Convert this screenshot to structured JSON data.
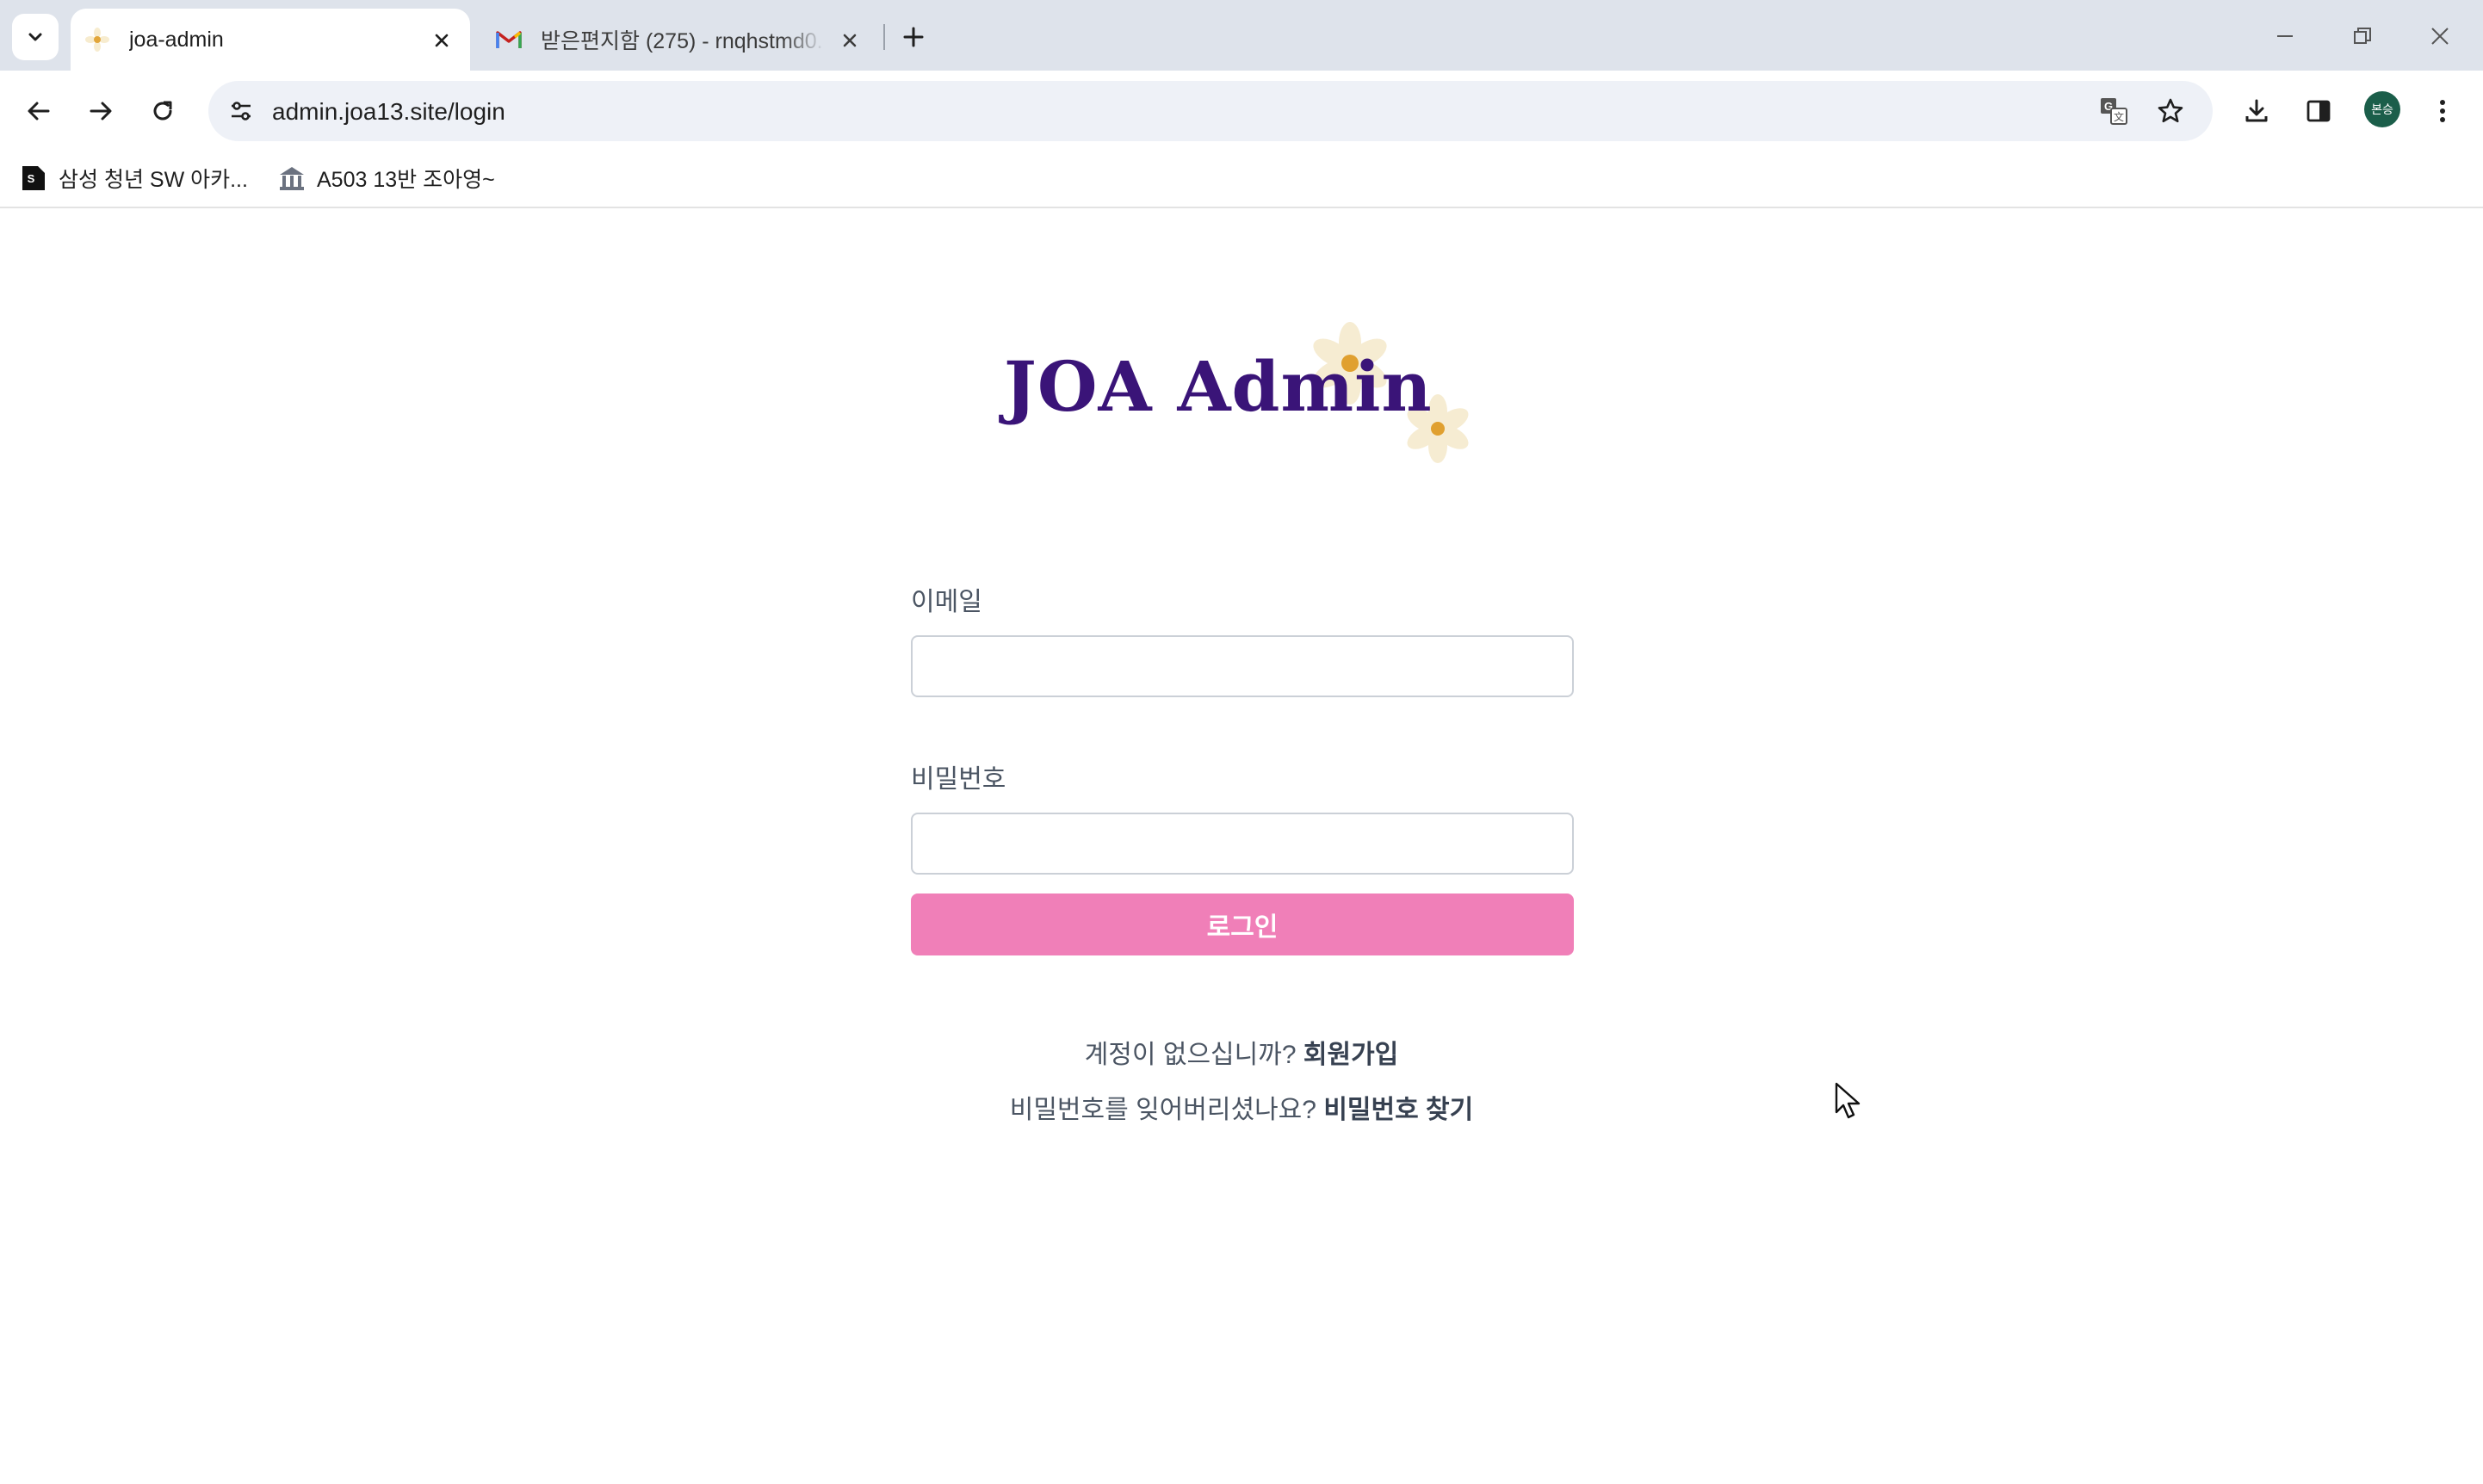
{
  "browser": {
    "tabs": [
      {
        "title": "joa-admin",
        "active": true
      },
      {
        "title": "받은편지함 (275) - rnqhstmd0...",
        "active": false
      }
    ],
    "url": "admin.joa13.site/login",
    "profile_initials": "본승",
    "bookmarks": [
      {
        "label": "삼성 청년 SW 아카...",
        "icon": "samsung-s-icon"
      },
      {
        "label": "A503 13반 조아영~",
        "icon": "building-icon"
      }
    ],
    "accent_color": "#dee3eb"
  },
  "page": {
    "logo_text": "JOA Admin",
    "email_label": "이메일",
    "email_value": "",
    "password_label": "비밀번호",
    "password_value": "",
    "login_button": "로그인",
    "signup_prompt": "계정이 없으십니까?",
    "signup_link": "회원가입",
    "forgot_prompt": "비밀번호를 잊어버리셨나요?",
    "forgot_link": "비밀번호 찾기",
    "button_color": "#f07fb8",
    "logo_color": "#3a1478"
  }
}
